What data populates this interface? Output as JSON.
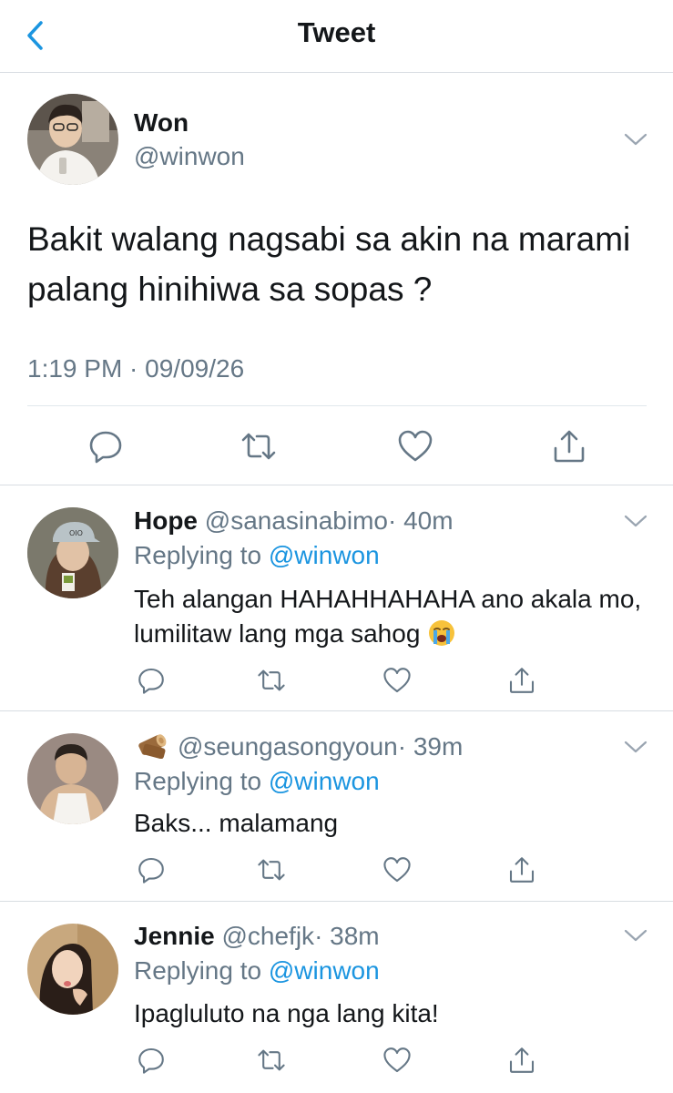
{
  "nav": {
    "title": "Tweet",
    "back_icon": "chevron-left-icon"
  },
  "main_tweet": {
    "name": "Won",
    "handle": "@winwon",
    "text": "Bakit walang nagsabi sa akin na marami palang hinihiwa sa sopas ?",
    "timestamp": "1:19 PM · 09/09/26"
  },
  "replies": [
    {
      "name": "Hope",
      "handle": "@sanasinabimo",
      "time": "· 40m",
      "replying_prefix": "Replying to",
      "replying_to": "@winwon",
      "text": "Teh alangan HAHAHHAHAHA ano akala mo, lumilitaw lang mga sahog",
      "emoji": "loudly-crying-face"
    },
    {
      "name": "",
      "name_icon": "log-icon",
      "handle": "@seungasongyoun",
      "time": "· 39m",
      "replying_prefix": "Replying to",
      "replying_to": "@winwon",
      "text": "Baks... malamang"
    },
    {
      "name": "Jennie",
      "handle": "@chefjk",
      "time": "· 38m",
      "replying_prefix": "Replying to",
      "replying_to": "@winwon",
      "text": "Ipagluluto na nga lang kita!"
    }
  ],
  "colors": {
    "link": "#1b95e0",
    "secondary": "#657786",
    "divider": "#d8dde2",
    "text": "#14171a"
  },
  "action_icons": [
    "reply-icon",
    "retweet-icon",
    "like-icon",
    "share-icon"
  ]
}
